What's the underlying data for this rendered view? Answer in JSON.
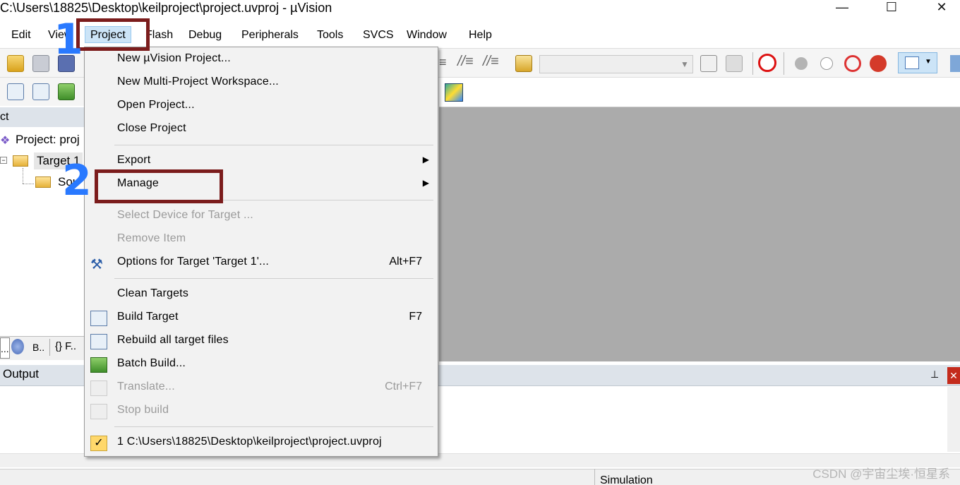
{
  "window": {
    "title": "C:\\Users\\18825\\Desktop\\keilproject\\project.uvproj - µVision",
    "minimize_glyph": "—",
    "maximize_glyph": "☐",
    "close_glyph": "✕"
  },
  "menubar": {
    "items": [
      {
        "label": "Edit"
      },
      {
        "label": "View"
      },
      {
        "label": "Project"
      },
      {
        "label": "Flash"
      },
      {
        "label": "Debug"
      },
      {
        "label": "Peripherals"
      },
      {
        "label": "Tools"
      },
      {
        "label": "SVCS"
      },
      {
        "label": "Window"
      },
      {
        "label": "Help"
      }
    ],
    "active": "Project"
  },
  "project_panel": {
    "header": "ct",
    "root": "Project: proj",
    "target": "Target 1",
    "group": "Sou",
    "tabs": [
      "...",
      "B..",
      "{} F.."
    ]
  },
  "dropdown": {
    "items": [
      {
        "label": "New µVision Project...",
        "shortcut": "",
        "enabled": true
      },
      {
        "label": "New Multi-Project Workspace...",
        "shortcut": "",
        "enabled": true
      },
      {
        "label": "Open Project...",
        "shortcut": "",
        "enabled": true
      },
      {
        "label": "Close Project",
        "shortcut": "",
        "enabled": true
      },
      {
        "label": "Export",
        "shortcut": "",
        "enabled": true,
        "submenu": true
      },
      {
        "label": "Manage",
        "shortcut": "",
        "enabled": true,
        "submenu": true
      },
      {
        "label": "Select Device for Target ...",
        "shortcut": "",
        "enabled": false
      },
      {
        "label": "Remove Item",
        "shortcut": "",
        "enabled": false
      },
      {
        "label": "Options for Target 'Target 1'...",
        "shortcut": "Alt+F7",
        "enabled": true
      },
      {
        "label": "Clean Targets",
        "shortcut": "",
        "enabled": true
      },
      {
        "label": "Build Target",
        "shortcut": "F7",
        "enabled": true
      },
      {
        "label": "Rebuild all target files",
        "shortcut": "",
        "enabled": true
      },
      {
        "label": "Batch Build...",
        "shortcut": "",
        "enabled": true
      },
      {
        "label": "Translate...",
        "shortcut": "Ctrl+F7",
        "enabled": false
      },
      {
        "label": "Stop build",
        "shortcut": "",
        "enabled": false
      },
      {
        "label": "1 C:\\Users\\18825\\Desktop\\keilproject\\project.uvproj",
        "shortcut": "",
        "enabled": true,
        "checked": true
      }
    ],
    "submenu_arrow": "▶",
    "check_glyph": "✓"
  },
  "output_panel": {
    "title": "Output",
    "pin_glyph": "📌",
    "close_glyph": "✕"
  },
  "statusbar": {
    "mode": "Simulation"
  },
  "annotations": {
    "step1": "1",
    "step2": "2"
  },
  "watermark": "CSDN @宇宙尘埃·恒星系",
  "colors": {
    "annotation_box": "#7b1c1c",
    "annotation_number": "#2979ff",
    "menu_highlight": "#cce4f7",
    "editor_bg": "#ababab"
  }
}
